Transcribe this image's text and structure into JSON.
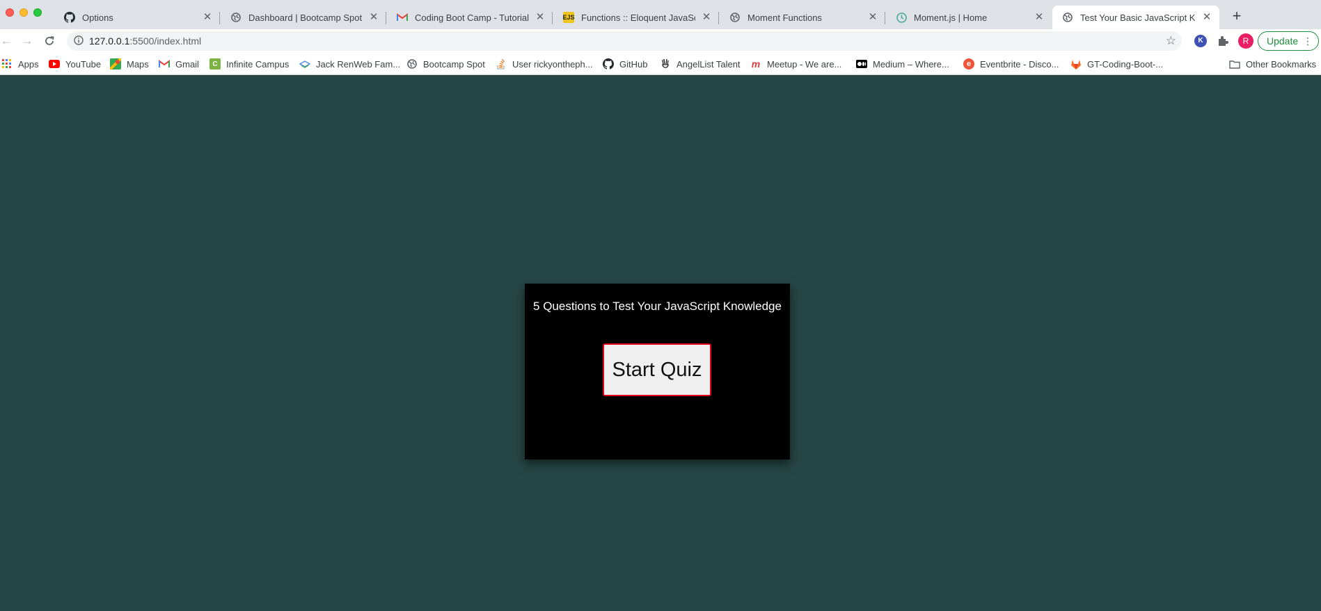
{
  "window_controls": [
    "close",
    "minimize",
    "maximize"
  ],
  "tabs": [
    {
      "title": "Options",
      "icon": "github-icon"
    },
    {
      "title": "Dashboard | Bootcamp Spot",
      "icon": "globe-icon"
    },
    {
      "title": "Coding Boot Camp - Tutorial C",
      "icon": "gmail-icon"
    },
    {
      "title": "Functions :: Eloquent JavaScrip",
      "icon": "eloquent-js-icon",
      "icon_text": "EJS"
    },
    {
      "title": "Moment Functions",
      "icon": "globe-icon"
    },
    {
      "title": "Moment.js | Home",
      "icon": "moment-clock-icon"
    },
    {
      "title": "Test Your Basic JavaScript Kno",
      "icon": "globe-icon",
      "active": true
    }
  ],
  "new_tab_label": "+",
  "toolbar": {
    "url_host": "127.0.0.1",
    "url_path": ":5500/index.html",
    "avatar_letter": "R",
    "extension_letter": "K",
    "update_label": "Update"
  },
  "bookmarks": [
    {
      "label": "Apps",
      "icon": "apps-grid-icon"
    },
    {
      "label": "YouTube",
      "icon": "youtube-icon"
    },
    {
      "label": "Maps",
      "icon": "maps-icon"
    },
    {
      "label": "Gmail",
      "icon": "gmail-icon"
    },
    {
      "label": "Infinite Campus",
      "icon": "infinite-campus-icon",
      "icon_text": "C"
    },
    {
      "label": "Jack RenWeb Fam...",
      "icon": "renweb-icon"
    },
    {
      "label": "Bootcamp Spot",
      "icon": "globe-icon"
    },
    {
      "label": "User rickyontheph...",
      "icon": "stackoverflow-icon"
    },
    {
      "label": "GitHub",
      "icon": "github-icon"
    },
    {
      "label": "AngelList Talent",
      "icon": "angellist-icon"
    },
    {
      "label": "Meetup - We are...",
      "icon": "meetup-icon"
    },
    {
      "label": "Medium – Where...",
      "icon": "medium-icon"
    },
    {
      "label": "Eventbrite - Disco...",
      "icon": "eventbrite-icon",
      "icon_text": "e"
    },
    {
      "label": "GT-Coding-Boot-...",
      "icon": "gitlab-icon"
    }
  ],
  "other_bookmarks_label": "Other Bookmarks",
  "quiz": {
    "title": "5 Questions to Test Your JavaScript Knowledge",
    "start_label": "Start Quiz"
  },
  "colors": {
    "page_background": "#264645",
    "card_background": "#000000",
    "button_border": "#e3001b",
    "update_green": "#1e8e3e"
  }
}
